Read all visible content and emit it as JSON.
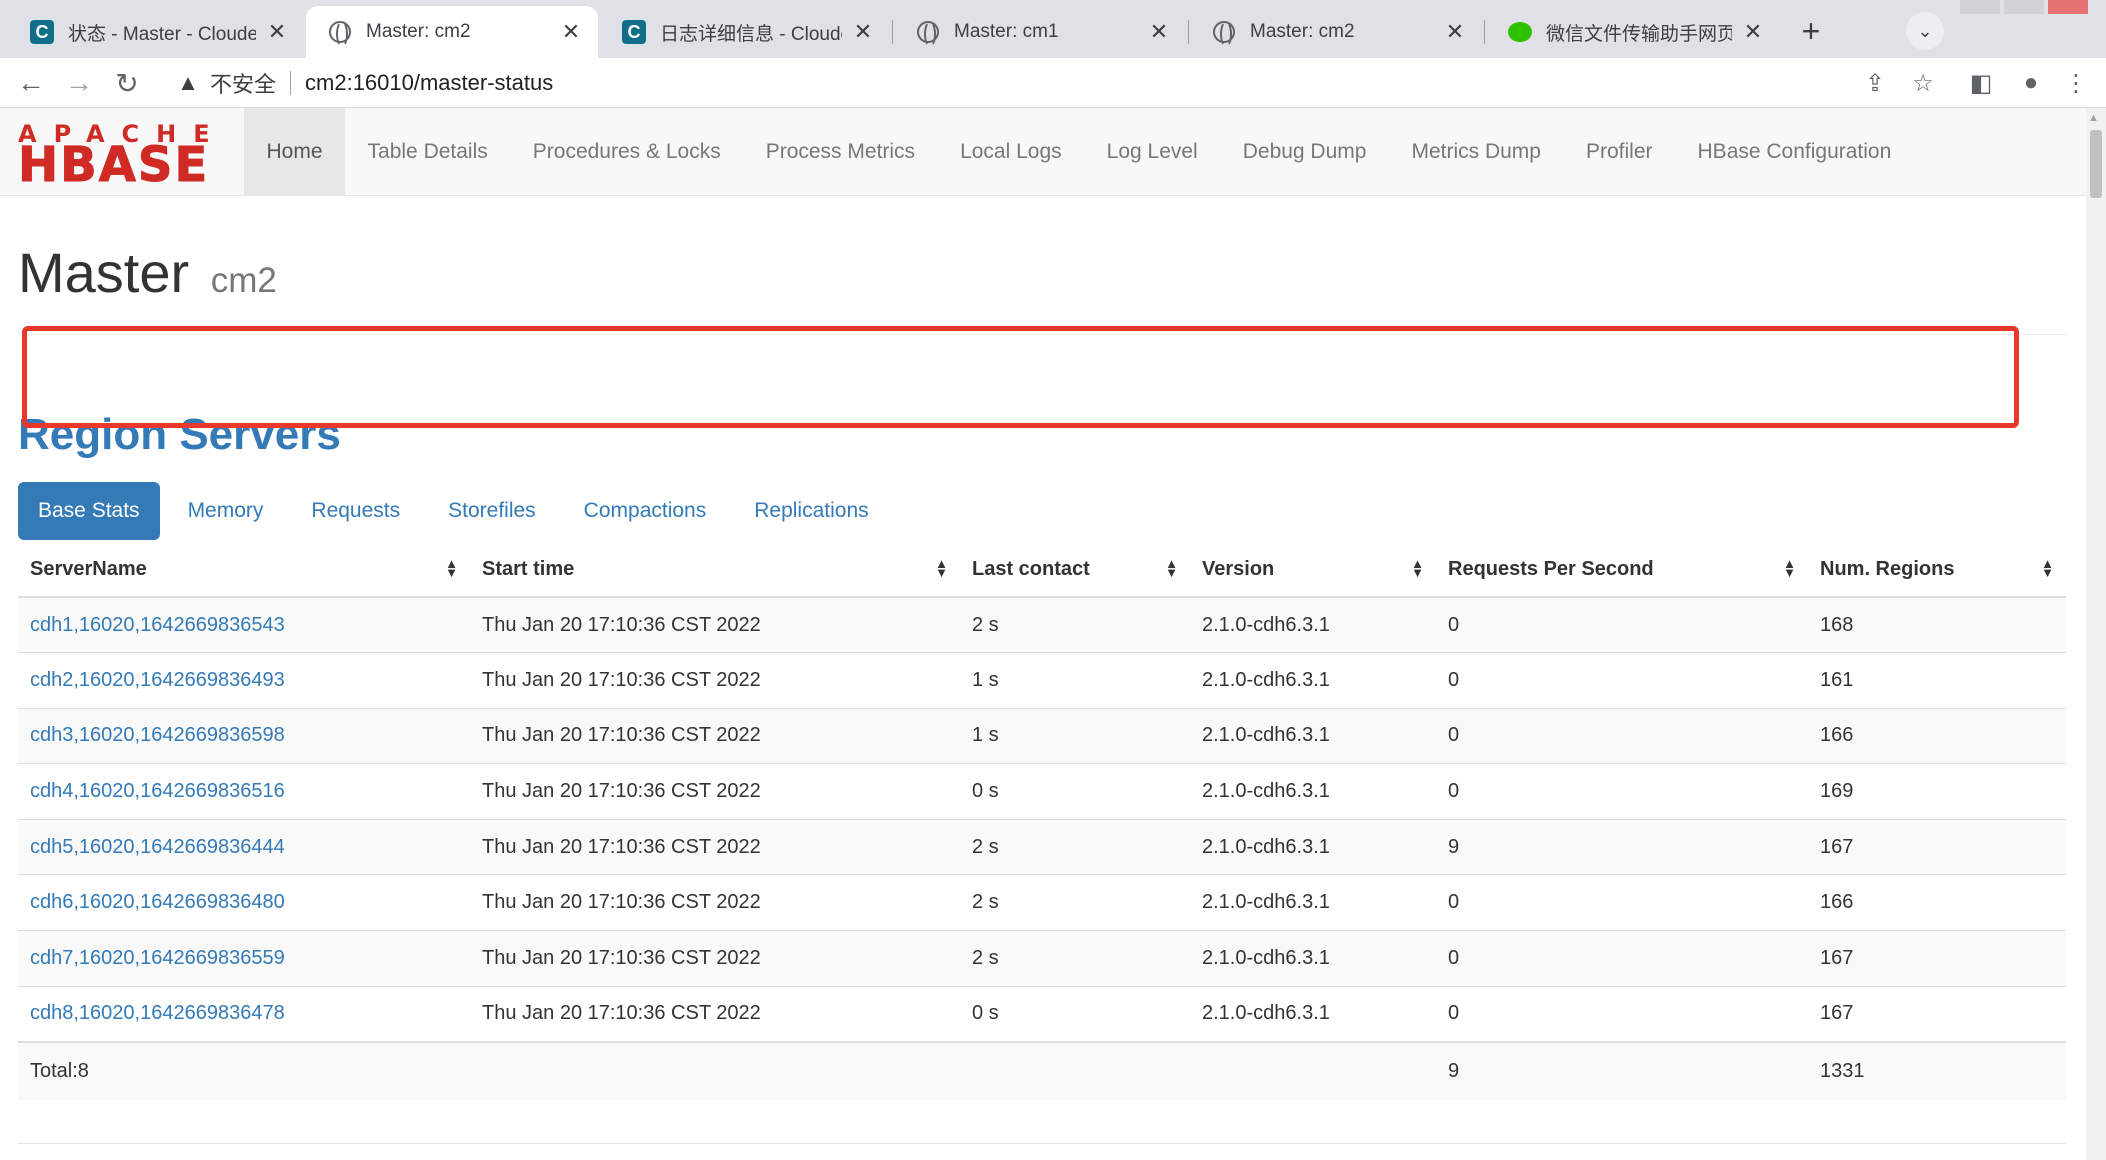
{
  "browser": {
    "tabs": [
      {
        "title": "状态 - Master - Cloudera",
        "favicon": "cloudera-c-icon",
        "active": false
      },
      {
        "title": "Master: cm2",
        "favicon": "globe-icon",
        "active": true
      },
      {
        "title": "日志详细信息 - Cloudera",
        "favicon": "cloudera-c-icon",
        "active": false
      },
      {
        "title": "Master: cm1",
        "favicon": "globe-icon",
        "active": false
      },
      {
        "title": "Master: cm2",
        "favicon": "globe-icon",
        "active": false
      },
      {
        "title": "微信文件传输助手网页版",
        "favicon": "wechat-icon",
        "active": false
      }
    ],
    "close_glyph": "✕",
    "new_tab_glyph": "+",
    "tab_list_glyph": "⌄",
    "security_label": "不安全",
    "url": "cm2:16010/master-status"
  },
  "hbase": {
    "logo_top": "APACHE",
    "logo_main": "HBASE",
    "nav": [
      "Home",
      "Table Details",
      "Procedures & Locks",
      "Process Metrics",
      "Local Logs",
      "Log Level",
      "Debug Dump",
      "Metrics Dump",
      "Profiler",
      "HBase Configuration"
    ],
    "active_nav": "Home"
  },
  "page": {
    "title": "Master",
    "host": "cm2",
    "section_title": "Region Servers"
  },
  "region_servers": {
    "tabs": [
      "Base Stats",
      "Memory",
      "Requests",
      "Storefiles",
      "Compactions",
      "Replications"
    ],
    "active_tab": "Base Stats",
    "columns": [
      "ServerName",
      "Start time",
      "Last contact",
      "Version",
      "Requests Per Second",
      "Num. Regions"
    ],
    "rows": [
      {
        "server": "cdh1,16020,1642669836543",
        "start": "Thu Jan 20 17:10:36 CST 2022",
        "last_contact": "2 s",
        "version": "2.1.0-cdh6.3.1",
        "rps": "0",
        "regions": "168"
      },
      {
        "server": "cdh2,16020,1642669836493",
        "start": "Thu Jan 20 17:10:36 CST 2022",
        "last_contact": "1 s",
        "version": "2.1.0-cdh6.3.1",
        "rps": "0",
        "regions": "161"
      },
      {
        "server": "cdh3,16020,1642669836598",
        "start": "Thu Jan 20 17:10:36 CST 2022",
        "last_contact": "1 s",
        "version": "2.1.0-cdh6.3.1",
        "rps": "0",
        "regions": "166"
      },
      {
        "server": "cdh4,16020,1642669836516",
        "start": "Thu Jan 20 17:10:36 CST 2022",
        "last_contact": "0 s",
        "version": "2.1.0-cdh6.3.1",
        "rps": "0",
        "regions": "169"
      },
      {
        "server": "cdh5,16020,1642669836444",
        "start": "Thu Jan 20 17:10:36 CST 2022",
        "last_contact": "2 s",
        "version": "2.1.0-cdh6.3.1",
        "rps": "9",
        "regions": "167"
      },
      {
        "server": "cdh6,16020,1642669836480",
        "start": "Thu Jan 20 17:10:36 CST 2022",
        "last_contact": "2 s",
        "version": "2.1.0-cdh6.3.1",
        "rps": "0",
        "regions": "166"
      },
      {
        "server": "cdh7,16020,1642669836559",
        "start": "Thu Jan 20 17:10:36 CST 2022",
        "last_contact": "2 s",
        "version": "2.1.0-cdh6.3.1",
        "rps": "0",
        "regions": "167"
      },
      {
        "server": "cdh8,16020,1642669836478",
        "start": "Thu Jan 20 17:10:36 CST 2022",
        "last_contact": "0 s",
        "version": "2.1.0-cdh6.3.1",
        "rps": "0",
        "regions": "167"
      }
    ],
    "total": {
      "label": "Total:8",
      "rps": "9",
      "regions": "1331"
    }
  },
  "colors": {
    "brand_red": "#d02a24",
    "link_blue": "#337ab7",
    "highlight_box": "#e8372b"
  }
}
